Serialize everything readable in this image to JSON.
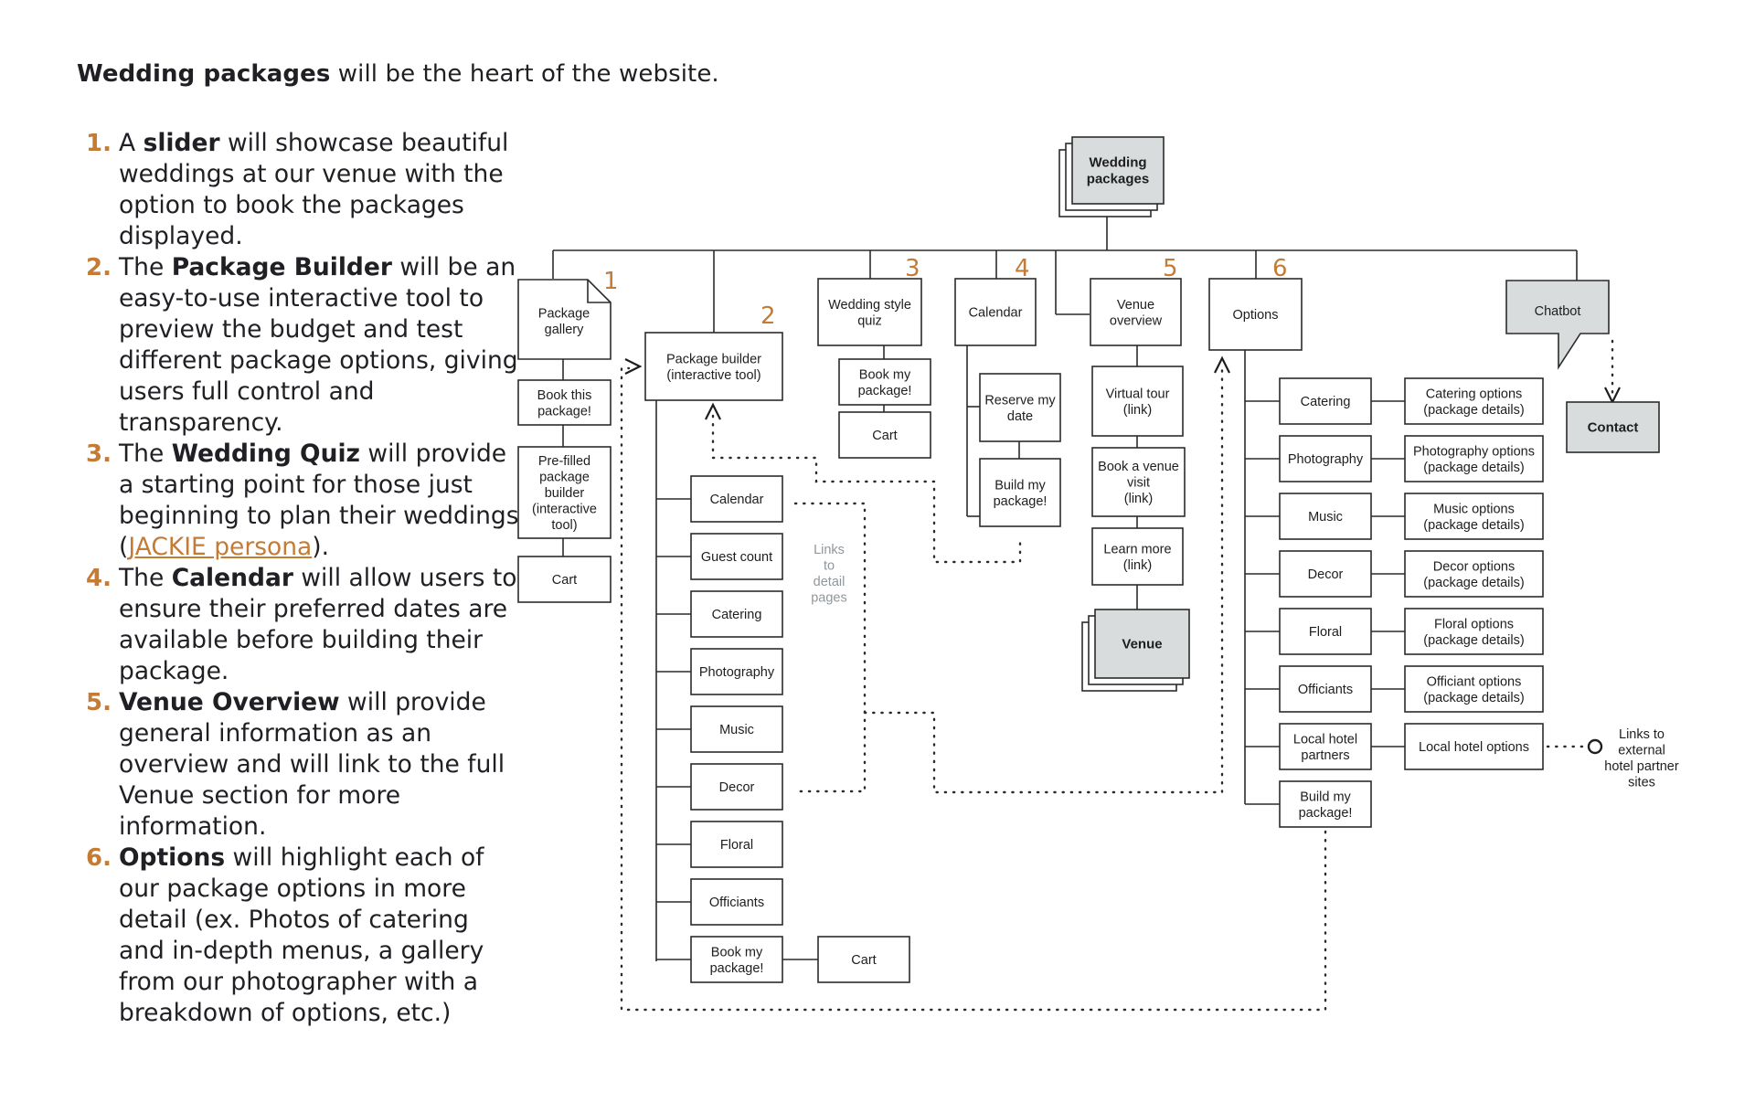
{
  "intro": {
    "bold": "Wedding packages",
    "rest": " will be the heart of the website."
  },
  "list": [
    {
      "num": "1.",
      "pre": "A ",
      "bold": "slider",
      "post": " will showcase beautiful weddings at our venue with the option to book the packages displayed."
    },
    {
      "num": "2.",
      "pre": "The ",
      "bold": "Package Builder",
      "post": " will be an easy-to-use interactive tool to preview the budget and test different package options, giving users full control and transparency."
    },
    {
      "num": "3.",
      "pre": "The ",
      "bold": "Wedding Quiz",
      "post": " will provide a starting point for those just beginning to plan their weddings (",
      "link": "JACKIE persona",
      "post2": ")."
    },
    {
      "num": "4.",
      "pre": "The ",
      "bold": "Calendar",
      "post": " will allow users to ensure their preferred dates are available before building their package."
    },
    {
      "num": "5.",
      "pre": "",
      "bold": "Venue Overview",
      "post": " will provide general information as an overview and will link to the full Venue section for more information."
    },
    {
      "num": "6.",
      "pre": "",
      "bold": "Options",
      "post": " will highlight each of our package options in more detail (ex. Photos of catering and in-depth menus, a gallery from our photographer with a breakdown of options, etc.)"
    }
  ],
  "diagram": {
    "root": [
      "Wedding",
      "packages"
    ],
    "section_numbers": [
      "1",
      "2",
      "3",
      "4",
      "5",
      "6"
    ],
    "gallery": {
      "title": [
        "Package",
        "gallery"
      ],
      "children": [
        [
          "Book this",
          "package!"
        ],
        [
          "Pre-filled",
          "package",
          "builder",
          "(interactive",
          "tool)"
        ],
        [
          "Cart"
        ]
      ]
    },
    "builder": {
      "title": [
        "Package builder",
        "(interactive tool)"
      ],
      "children": [
        [
          "Calendar"
        ],
        [
          "Guest count"
        ],
        [
          "Catering"
        ],
        [
          "Photography"
        ],
        [
          "Music"
        ],
        [
          "Decor"
        ],
        [
          "Floral"
        ],
        [
          "Officiants"
        ],
        [
          "Book my",
          "package!"
        ]
      ],
      "cart": [
        "Cart"
      ],
      "note": [
        "Links",
        "to",
        "detail",
        "pages"
      ]
    },
    "quiz": {
      "title": [
        "Wedding style",
        "quiz"
      ],
      "children": [
        [
          "Book my",
          "package!"
        ],
        [
          "Cart"
        ]
      ]
    },
    "calendar": {
      "title": [
        "Calendar"
      ],
      "children": [
        [
          "Reserve my",
          "date"
        ],
        [
          "Build my",
          "package!"
        ]
      ]
    },
    "venue": {
      "title": [
        "Venue",
        "overview"
      ],
      "children": [
        [
          "Virtual tour",
          "(link)"
        ],
        [
          "Book a venue",
          "visit",
          "(link)"
        ],
        [
          "Learn more",
          "(link)"
        ]
      ],
      "section": [
        "Venue"
      ]
    },
    "options": {
      "title": [
        "Options"
      ],
      "children": [
        {
          "label": [
            "Catering"
          ],
          "detail": [
            "Catering options",
            "(package details)"
          ]
        },
        {
          "label": [
            "Photography"
          ],
          "detail": [
            "Photography options",
            "(package details)"
          ]
        },
        {
          "label": [
            "Music"
          ],
          "detail": [
            "Music options",
            "(package details)"
          ]
        },
        {
          "label": [
            "Decor"
          ],
          "detail": [
            "Decor options",
            "(package details)"
          ]
        },
        {
          "label": [
            "Floral"
          ],
          "detail": [
            "Floral options",
            "(package details)"
          ]
        },
        {
          "label": [
            "Officiants"
          ],
          "detail": [
            "Officiant options",
            "(package details)"
          ]
        },
        {
          "label": [
            "Local hotel",
            "partners"
          ],
          "detail": [
            "Local hotel options"
          ]
        },
        {
          "label": [
            "Build my",
            "package!"
          ]
        }
      ],
      "external_note": [
        "Links to",
        "external",
        "hotel partner",
        "sites"
      ]
    },
    "chatbot": [
      "Chatbot"
    ],
    "contact": [
      "Contact"
    ]
  }
}
